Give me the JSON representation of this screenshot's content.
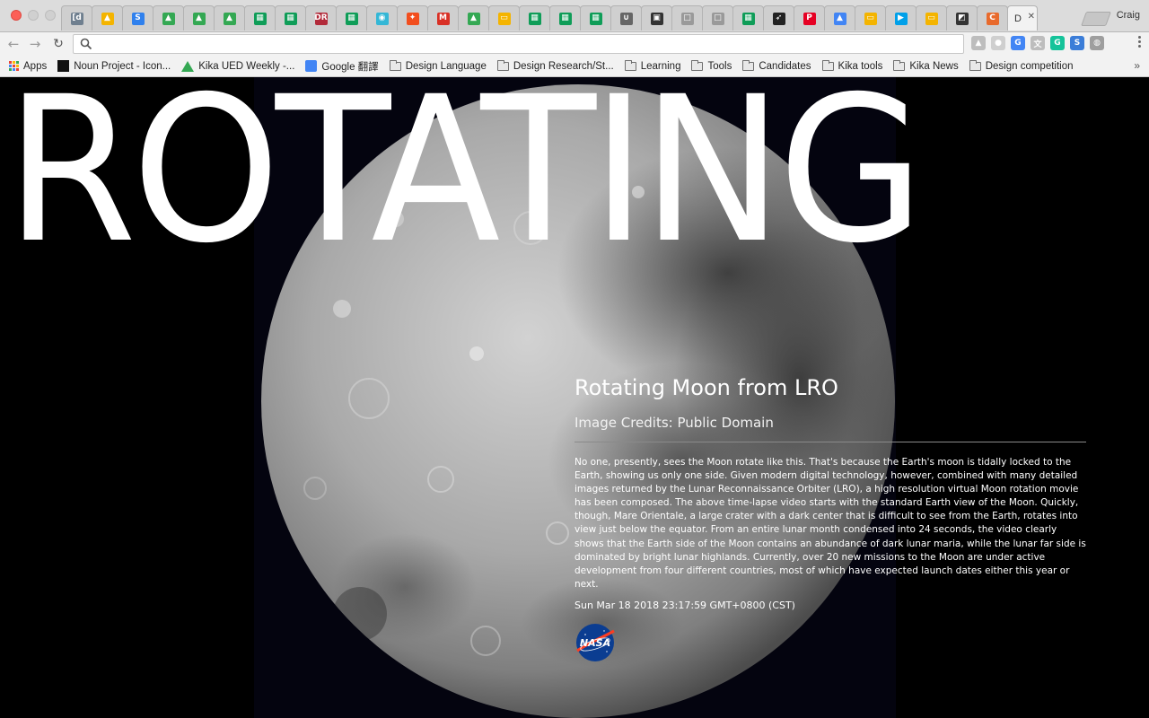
{
  "browser": {
    "profile_name": "Craig",
    "active_tab_label": "D",
    "tabs": [
      {
        "icon": "doc-icon",
        "color": "#6f7f8f",
        "glyph": "[d"
      },
      {
        "icon": "drive-icon",
        "color": "#f4b400",
        "glyph": "▲"
      },
      {
        "icon": "s-icon",
        "color": "#2f80ed",
        "glyph": "S"
      },
      {
        "icon": "drive-icon",
        "color": "#34a853",
        "glyph": "▲"
      },
      {
        "icon": "drive-icon",
        "color": "#34a853",
        "glyph": "▲"
      },
      {
        "icon": "drive-icon",
        "color": "#34a853",
        "glyph": "▲"
      },
      {
        "icon": "sheets-icon",
        "color": "#0f9d58",
        "glyph": "▦"
      },
      {
        "icon": "sheets-icon",
        "color": "#0f9d58",
        "glyph": "▦"
      },
      {
        "icon": "dr-icon",
        "color": "#b22a3a",
        "glyph": "DR"
      },
      {
        "icon": "sheets-icon",
        "color": "#0f9d58",
        "glyph": "▦"
      },
      {
        "icon": "bird-icon",
        "color": "#34b7d6",
        "glyph": "◉"
      },
      {
        "icon": "figma-icon",
        "color": "#f24e1e",
        "glyph": "✦"
      },
      {
        "icon": "gmail-icon",
        "color": "#d93025",
        "glyph": "M"
      },
      {
        "icon": "drive-icon",
        "color": "#34a853",
        "glyph": "▲"
      },
      {
        "icon": "slides-icon",
        "color": "#f4b400",
        "glyph": "▭"
      },
      {
        "icon": "sheets-icon",
        "color": "#0f9d58",
        "glyph": "▦"
      },
      {
        "icon": "sheets-icon",
        "color": "#0f9d58",
        "glyph": "▦"
      },
      {
        "icon": "sheets-icon",
        "color": "#0f9d58",
        "glyph": "▦"
      },
      {
        "icon": "u-icon",
        "color": "#666666",
        "glyph": "∪"
      },
      {
        "icon": "notes-icon",
        "color": "#333333",
        "glyph": "▣"
      },
      {
        "icon": "blank-icon",
        "color": "#9a9a9a",
        "glyph": "□"
      },
      {
        "icon": "blank-icon",
        "color": "#9a9a9a",
        "glyph": "□"
      },
      {
        "icon": "sheets-icon",
        "color": "#0f9d58",
        "glyph": "▦"
      },
      {
        "icon": "feather-icon",
        "color": "#222222",
        "glyph": "➶"
      },
      {
        "icon": "pinterest-icon",
        "color": "#e60023",
        "glyph": "P"
      },
      {
        "icon": "drive-icon",
        "color": "#4285f4",
        "glyph": "▲"
      },
      {
        "icon": "slides-icon",
        "color": "#f4b400",
        "glyph": "▭"
      },
      {
        "icon": "play-icon",
        "color": "#00a0e9",
        "glyph": "▶"
      },
      {
        "icon": "slides-icon",
        "color": "#f4b400",
        "glyph": "▭"
      },
      {
        "icon": "multi-icon",
        "color": "#333333",
        "glyph": "◩"
      },
      {
        "icon": "c-icon",
        "color": "#e86a2c",
        "glyph": "C"
      }
    ],
    "extensions": [
      {
        "icon": "drive-ext-icon",
        "color": "#bdbdbd",
        "glyph": "▲"
      },
      {
        "icon": "circle-ext-icon",
        "color": "#cfcfcf",
        "glyph": "●"
      },
      {
        "icon": "translate-ext-icon",
        "color": "#4285f4",
        "glyph": "G"
      },
      {
        "icon": "docs-ext-icon",
        "color": "#bdbdbd",
        "glyph": "文"
      },
      {
        "icon": "grammarly-ext-icon",
        "color": "#15c39a",
        "glyph": "G"
      },
      {
        "icon": "s-ext-icon",
        "color": "#3b7dd8",
        "glyph": "S"
      },
      {
        "icon": "globe-ext-icon",
        "color": "#9e9e9e",
        "glyph": "◍"
      }
    ],
    "bookmarks": [
      {
        "label": "Apps",
        "icon": "apps-grid-icon"
      },
      {
        "label": "Noun Project - Icon...",
        "icon": "noun-project-icon"
      },
      {
        "label": "Kika UED Weekly -...",
        "icon": "drive-icon"
      },
      {
        "label": "Google 翻譯",
        "icon": "translate-icon"
      },
      {
        "label": "Design Language",
        "icon": "folder-icon"
      },
      {
        "label": "Design Research/St...",
        "icon": "folder-icon"
      },
      {
        "label": "Learning",
        "icon": "folder-icon"
      },
      {
        "label": "Tools",
        "icon": "folder-icon"
      },
      {
        "label": "Candidates",
        "icon": "folder-icon"
      },
      {
        "label": "Kika tools",
        "icon": "folder-icon"
      },
      {
        "label": "Kika News",
        "icon": "folder-icon"
      },
      {
        "label": "Design competition",
        "icon": "folder-icon"
      }
    ]
  },
  "page": {
    "hero_title": "ROTATING",
    "title": "Rotating Moon from LRO",
    "credit": "Image Credits: Public Domain",
    "description": "No one, presently, sees the Moon rotate like this. That's because the Earth's moon is tidally locked to the Earth, showing us only one side. Given modern digital technology, however, combined with many detailed images returned by the Lunar Reconnaissance Orbiter (LRO), a high resolution virtual Moon rotation movie has been composed. The above time-lapse video starts with the standard Earth view of the Moon. Quickly, though, Mare Orientale, a large crater with a dark center that is difficult to see from the Earth, rotates into view just below the equator. From an entire lunar month condensed into 24 seconds, the video clearly shows that the Earth side of the Moon contains an abundance of dark lunar maria, while the lunar far side is dominated by bright lunar highlands. Currently, over 20 new missions to the Moon are under active development from four different countries, most of which have expected launch dates either this year or next.",
    "date": "Sun Mar 18 2018 23:17:59 GMT+0800 (CST)",
    "logo_text": "NASA"
  }
}
